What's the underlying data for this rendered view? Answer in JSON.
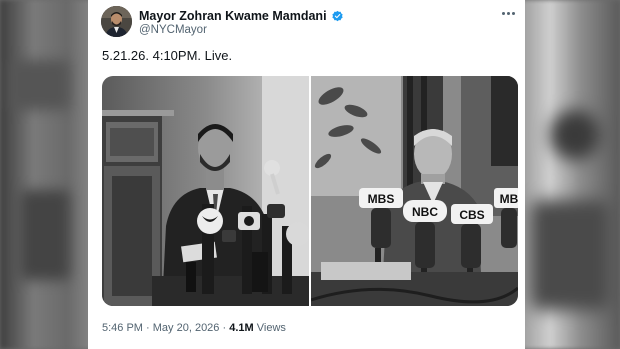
{
  "tweet": {
    "display_name": "Mayor Zohran Kwame Mamdani",
    "handle": "@NYCMayor",
    "text": "5.21.26. 4:10PM. Live.",
    "time": "5:46 PM",
    "separator": "·",
    "date": "May 20, 2026",
    "views_count": "4.1M",
    "views_label": "Views"
  },
  "photos": {
    "right_mic_labels": [
      "MBS",
      "NBC",
      "CBS",
      "MB"
    ]
  },
  "icons": {
    "verified": "verified-badge-icon",
    "more": "more-options-icon"
  },
  "colors": {
    "verified": "#1d9bf0",
    "primary_text": "#0f1419",
    "secondary_text": "#536471"
  }
}
